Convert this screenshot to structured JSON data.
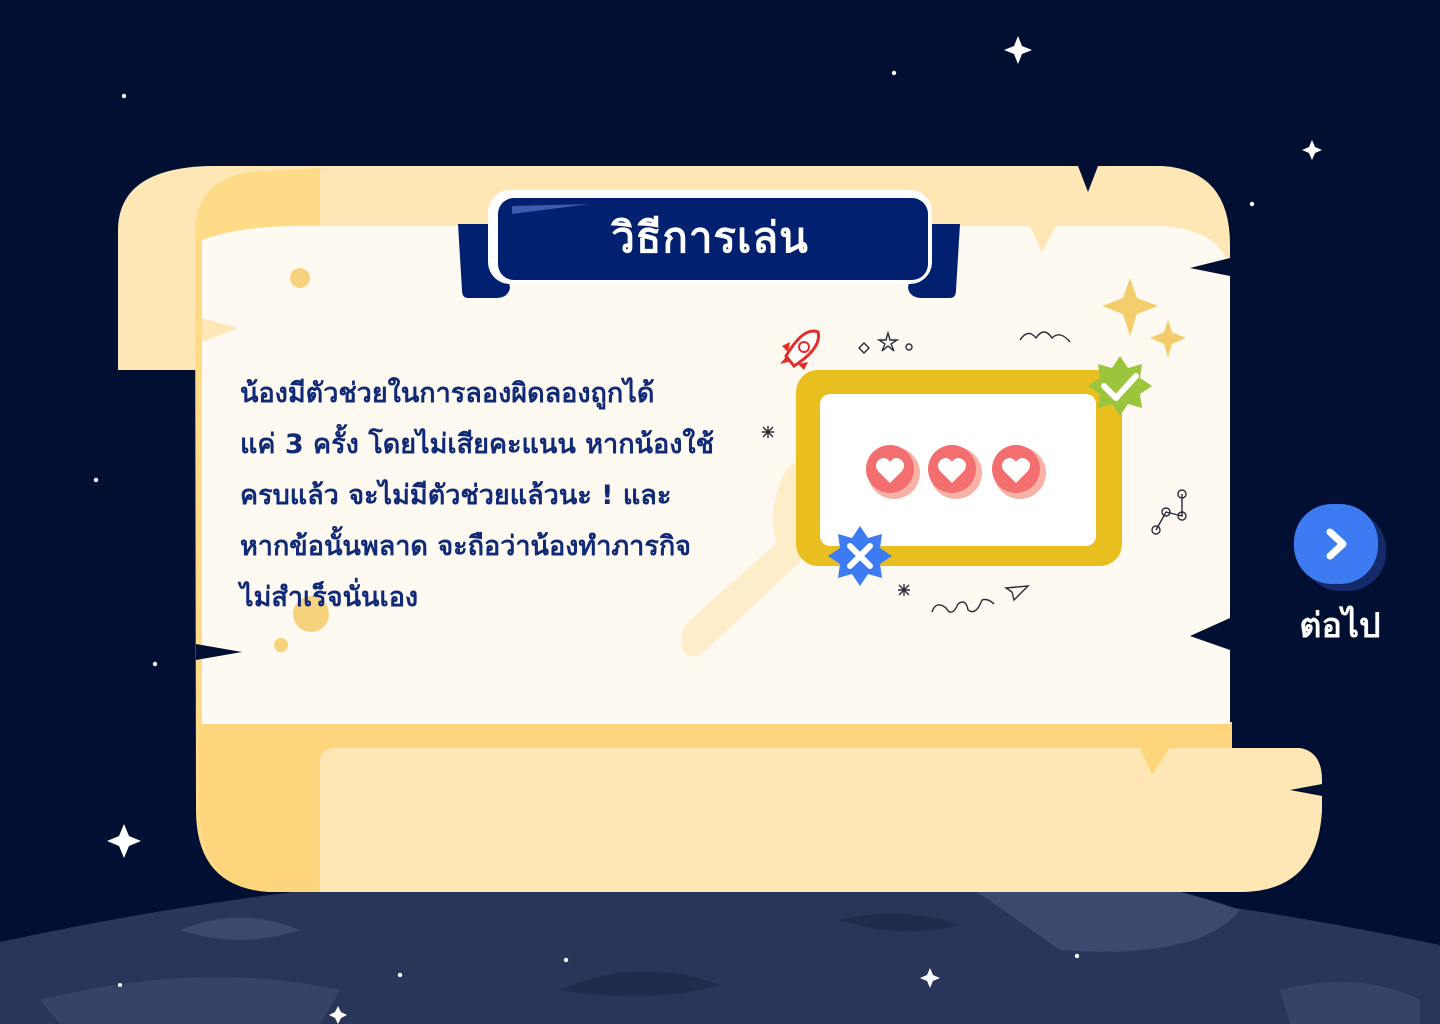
{
  "dialog": {
    "title": "วิธีการเล่น",
    "body_lines": [
      "น้องมีตัวช่วยในการลองผิดลองถูกได้",
      "แค่ 3 ครั้ง โดยไม่เสียคะแนน หากน้องใช้",
      "ครบแล้ว จะไม่มีตัวช่วยแล้วนะ !  และ",
      "หากข้อนั้นพลาด จะถือว่าน้องทำภารกิจ",
      "ไม่สำเร็จนั่นเอง"
    ]
  },
  "illustration": {
    "lives": 3,
    "heart_icon": "heart-icon",
    "badges": [
      "check-badge-icon",
      "close-badge-icon"
    ]
  },
  "navigation": {
    "next_label": "ต่อไป",
    "next_icon": "chevron-right-icon"
  },
  "colors": {
    "background": "#010f33",
    "scroll": "#fee7b5",
    "paper": "#fefaf1",
    "banner": "#01206f",
    "text": "#102a78",
    "accent_button": "#3d7bf2",
    "frame": "#e8bf1f",
    "heart": "#f36f6f"
  }
}
